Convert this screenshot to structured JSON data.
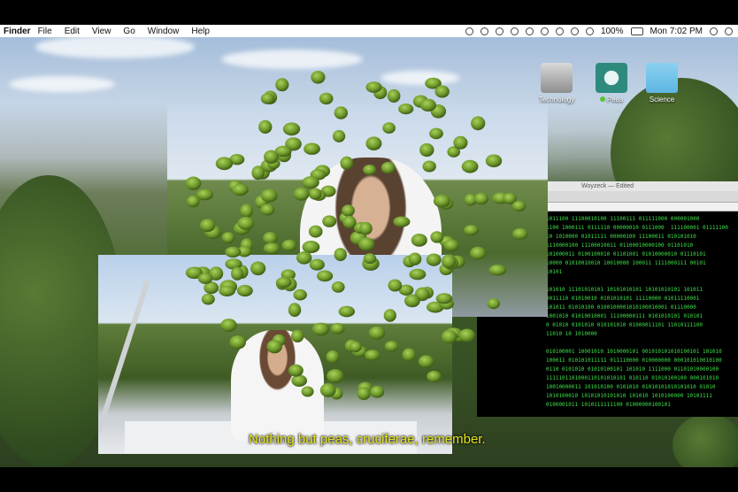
{
  "menubar": {
    "app_name": "Finder",
    "items": [
      "File",
      "Edit",
      "View",
      "Go",
      "Window",
      "Help"
    ],
    "battery": "100%",
    "clock": "Mon 7:02 PM"
  },
  "desktop_icons": [
    {
      "label": "Technology",
      "icon": "hard-drive-icon",
      "color": "#b9b9b9"
    },
    {
      "label": "Peas",
      "icon": "time-machine-icon",
      "color": "#2e8a7d",
      "tag_color": "#57c53b"
    },
    {
      "label": "Science",
      "icon": "folder-icon",
      "color": "#71c4ea"
    }
  ],
  "terminal": {
    "title": "Woyzeck — Edited",
    "lines": [
      "1011100 11100010100 11100111 011111000 000001000",
      "1100 1000111 0111110 00000010 0111000  111100001 01111100",
      "10 1010000 01011111 00000100 11100011 010101010",
      "1110000100 11100010011 01100010000100 01101010",
      "101000011 0100100010 01101001 01010000010 01110101",
      "10000 01010010010 10010000 100011 1111000111 00101",
      "10101",
      "",
      "101010 11101010101 10101010101 10101010101 101011",
      "0011110 01010010 0101010101 11110000 01011110001",
      "101011 01010100 0100100001010100010001 01110000",
      "1001010 01010010001 11100000111 0101010101 010101",
      "0 01010 0101010 010101010 01000011101 11010111100",
      "11010 10 1010000",
      "",
      "010100001 10001010 1010000101 001010101010100101 101010",
      "100011 010101011111 011110000 010000000 000101010010100",
      "0110 0101010 01010100101 101010 1111000 01101010000100",
      "1111101101000110101010101 010110 01010100100 000101010",
      "10010000011 101010100 0101010 01010101010101010 01010",
      "1010100010 10101010101010 101010 1010100000 10101111",
      "0100001011 1010111111100 01000000100101"
    ]
  },
  "video": {
    "subtitle": "Nothing but peas, cruciferae, remember."
  }
}
